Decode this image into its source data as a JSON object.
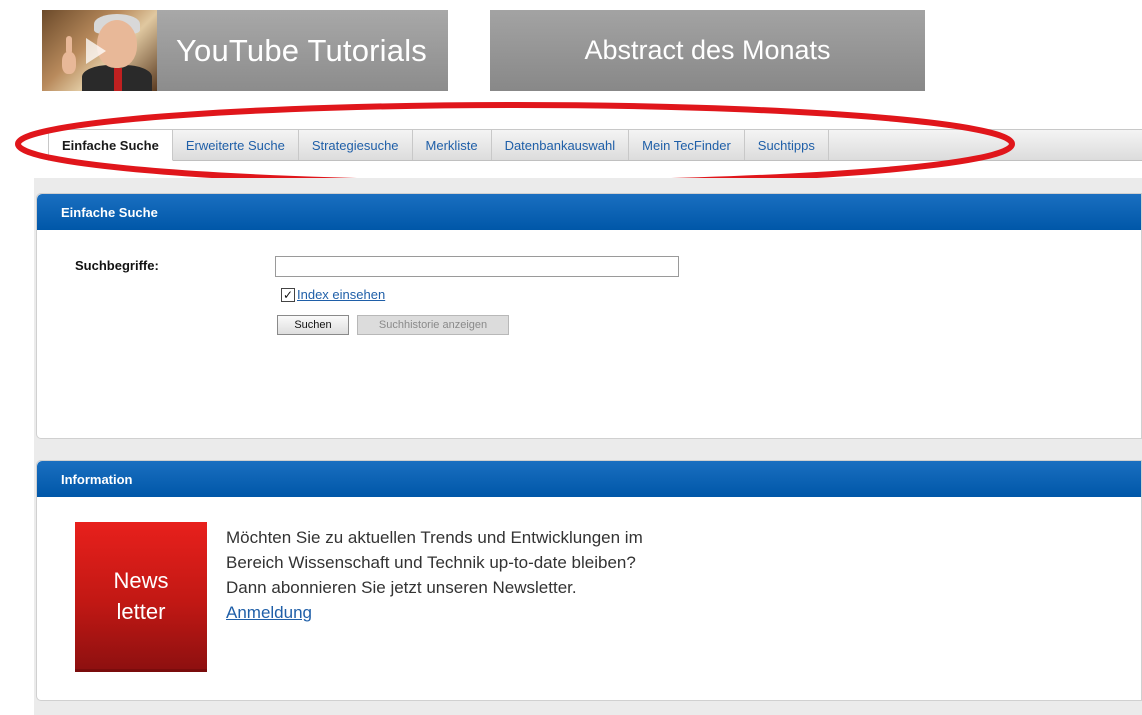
{
  "header": {
    "youtube_banner": {
      "title": "YouTube Tutorials"
    },
    "abstract_banner": {
      "title": "Abstract des Monats"
    }
  },
  "tabs": [
    {
      "label": "Einfache Suche",
      "active": true
    },
    {
      "label": "Erweiterte Suche",
      "active": false
    },
    {
      "label": "Strategiesuche",
      "active": false
    },
    {
      "label": "Merkliste",
      "active": false
    },
    {
      "label": "Datenbankauswahl",
      "active": false
    },
    {
      "label": "Mein TecFinder",
      "active": false
    },
    {
      "label": "Suchtipps",
      "active": false
    }
  ],
  "search_panel": {
    "title": "Einfache Suche",
    "field_label": "Suchbegriffe:",
    "input_value": "",
    "index_checkbox": {
      "label": "Index einsehen",
      "checked": true
    },
    "search_button": "Suchen",
    "history_button": "Suchhistorie anzeigen"
  },
  "info_panel": {
    "title": "Information",
    "badge": {
      "line1": "News",
      "line2": "letter"
    },
    "text_lines": [
      "Möchten Sie zu aktuellen Trends und Entwicklungen im",
      "Bereich Wissenschaft und Technik up-to-date bleiben?",
      "Dann abonnieren Sie jetzt unseren Newsletter."
    ],
    "link": "Anmeldung"
  },
  "colors": {
    "accent_blue": "#0057a8",
    "link_blue": "#1f5fa8",
    "newsletter_red": "#c11814",
    "marker_red": "#e0161b"
  }
}
